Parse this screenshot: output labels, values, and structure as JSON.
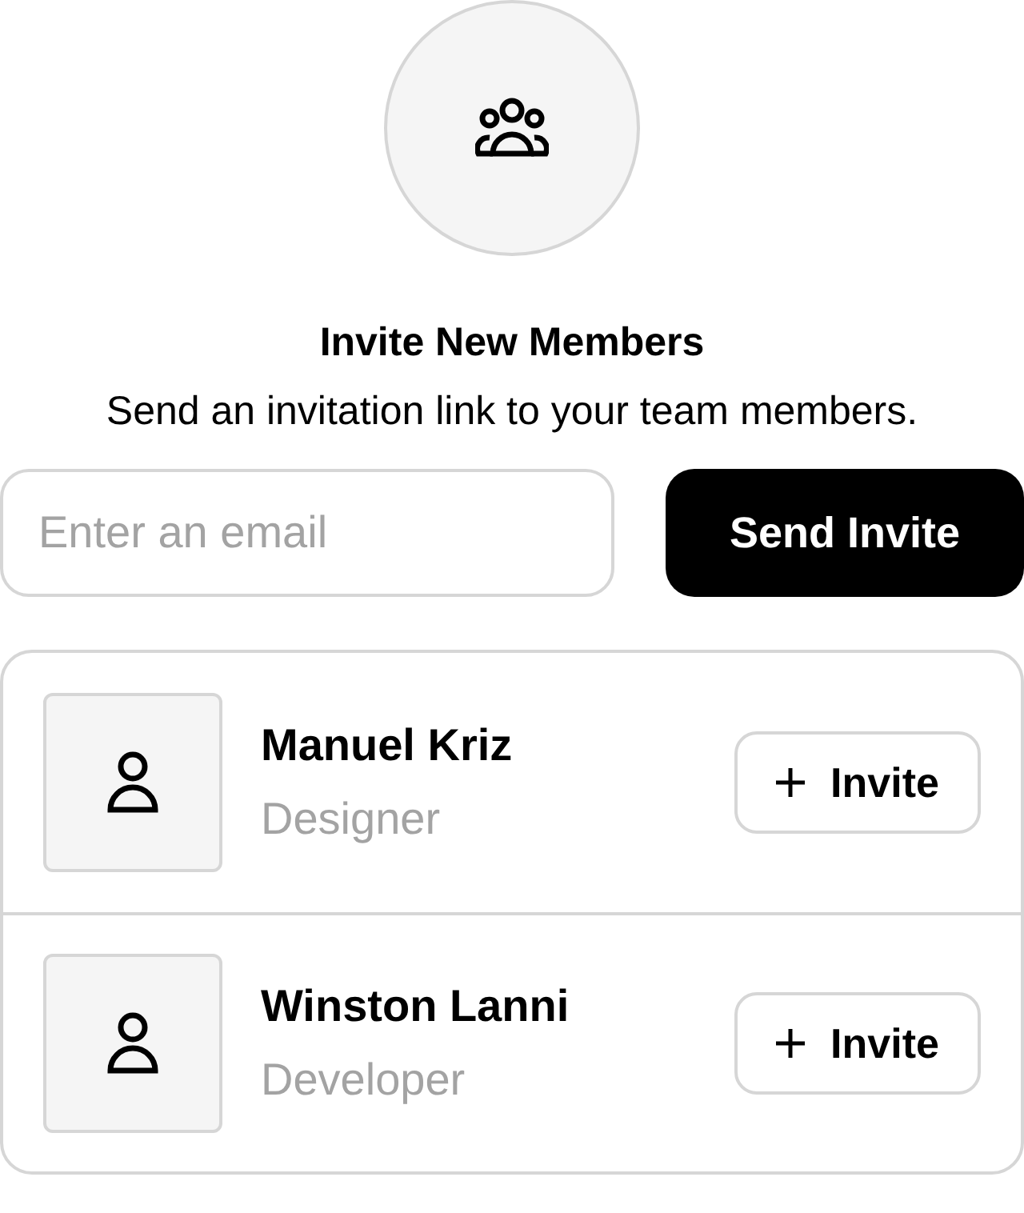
{
  "header": {
    "title": "Invite New Members",
    "subtitle": "Send an invitation link to your team members."
  },
  "invite_form": {
    "placeholder": "Enter an email",
    "button": "Send Invite"
  },
  "members": [
    {
      "name": "Manuel Kriz",
      "role": "Designer",
      "action": "Invite"
    },
    {
      "name": "Winston Lanni",
      "role": "Developer",
      "action": "Invite"
    }
  ]
}
